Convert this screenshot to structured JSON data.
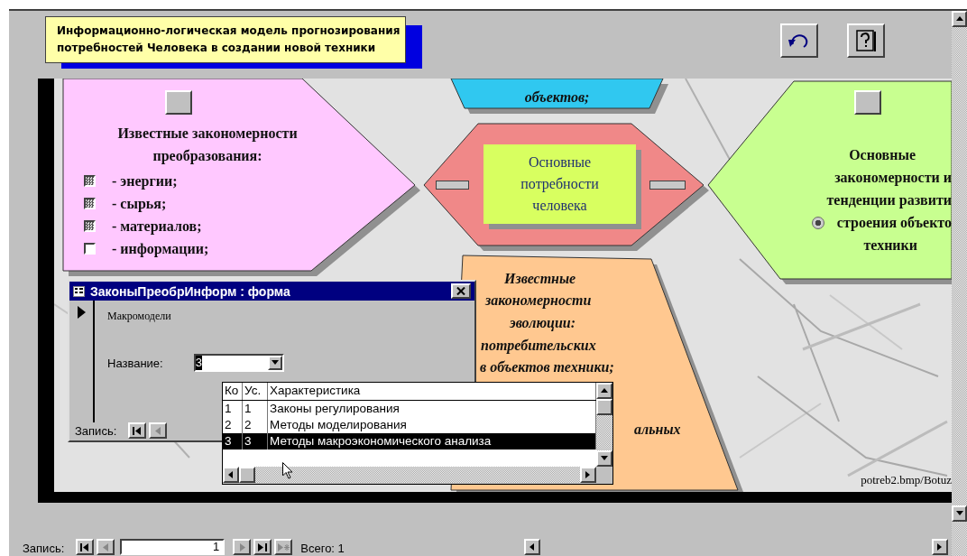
{
  "header": {
    "title_lines": [
      "Информационно-логическая модель прогнозирования",
      "потребностей Человека в создании новой техники"
    ],
    "buttons": [
      {
        "kind": "undo"
      },
      {
        "kind": "help"
      }
    ]
  },
  "diagram": {
    "left_node": {
      "heading_lines": [
        "Известные закономерности",
        "преобразования:"
      ],
      "items": [
        {
          "label": "- энергии;",
          "checked": true
        },
        {
          "label": "- сырья;",
          "checked": true
        },
        {
          "label": "- материалов;",
          "checked": true
        },
        {
          "label": "- информации;",
          "checked": false
        }
      ]
    },
    "top_node": {
      "text": "объектов;"
    },
    "center_node": {
      "lines": [
        "Основные",
        "потребности",
        "человека"
      ]
    },
    "right_node": {
      "lines": [
        "Основные",
        "закономерности и",
        "тенденции  развити"
      ],
      "radio": {
        "label": "строения объекто",
        "checked": true
      },
      "last_line": "техники"
    },
    "bottom_node": {
      "lines": [
        "Известные",
        "закономерности",
        "эволюции:",
        "потребительских",
        "в объектов техники;",
        "альных"
      ]
    },
    "caption": "potreb2.bmp/Botuz"
  },
  "dialog": {
    "title": "ЗаконыПреобрИнформ : форма",
    "section": "Макромодели",
    "field_label": "Название:",
    "field_value": "3",
    "record_label": "Запись:",
    "nav": [
      {
        "kind": "first",
        "disabled": false
      },
      {
        "kind": "prev",
        "disabled": true
      }
    ],
    "list": {
      "columns": [
        "Ко",
        "Ус.",
        "Характеристика"
      ],
      "rows": [
        {
          "cells": [
            "1",
            "1",
            "Законы регулирования"
          ],
          "selected": false
        },
        {
          "cells": [
            "2",
            "2",
            "Методы моделирования"
          ],
          "selected": false
        },
        {
          "cells": [
            "3",
            "3",
            "Методы макроэкономического анализа"
          ],
          "selected": true
        }
      ]
    }
  },
  "footer": {
    "record_label": "Запись:",
    "record_number": "1",
    "total": "Всего: 1",
    "nav": [
      {
        "kind": "first",
        "disabled": false
      },
      {
        "kind": "prev",
        "disabled": true
      },
      {
        "kind": "next",
        "disabled": true
      },
      {
        "kind": "last",
        "disabled": false
      },
      {
        "kind": "new",
        "disabled": true
      }
    ]
  }
}
